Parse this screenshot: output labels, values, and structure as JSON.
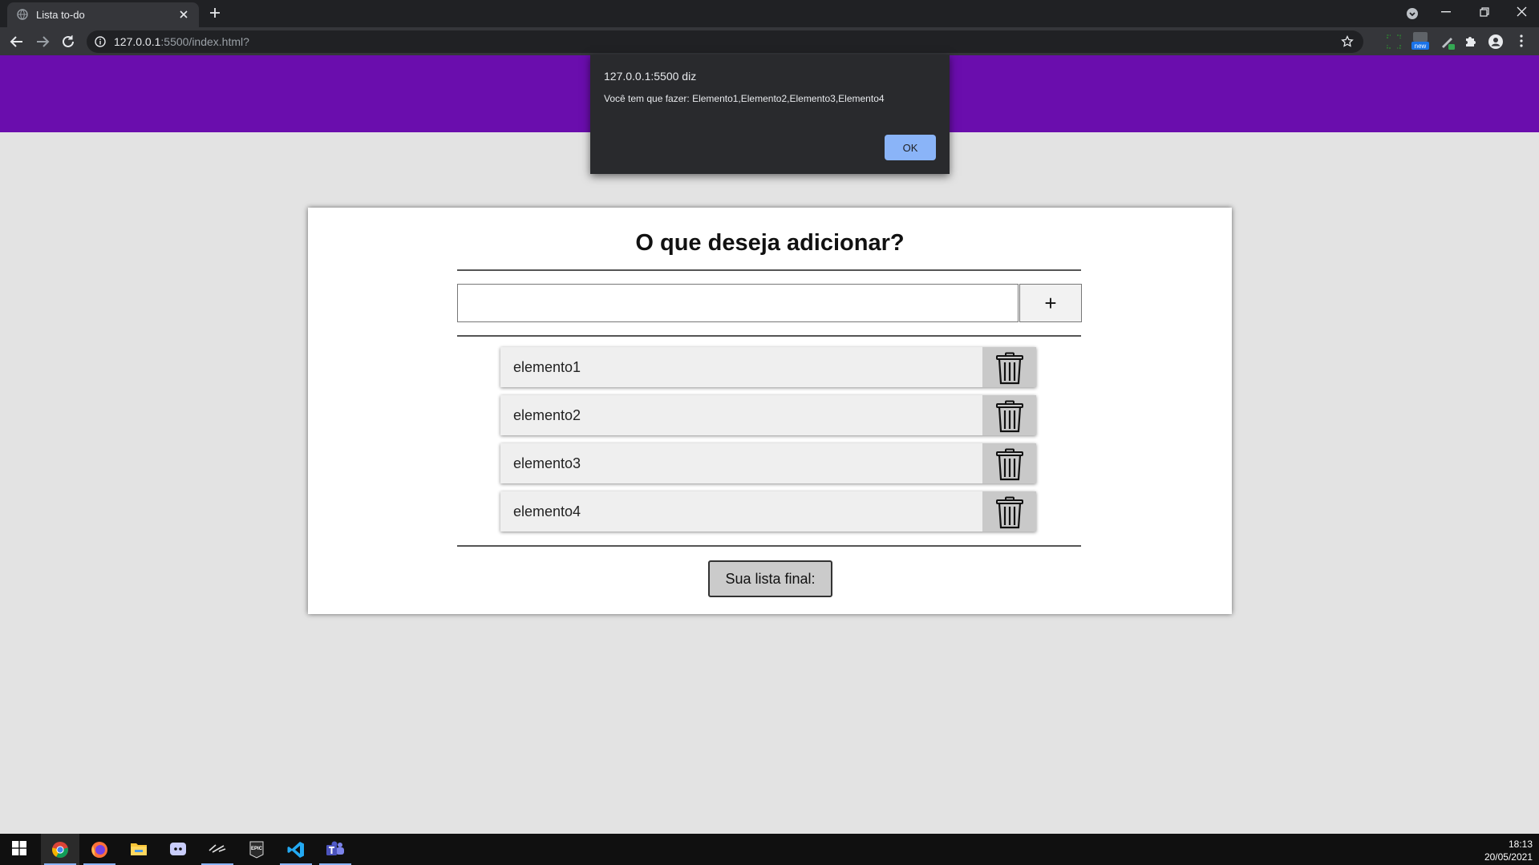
{
  "browser": {
    "tab_title": "Lista to-do",
    "url_host": "127.0.0.1",
    "url_path": ":5500/index.html?",
    "extension_badge": "new"
  },
  "alert": {
    "title": "127.0.0.1:5500 diz",
    "message": "Você tem que fazer: Elemento1,Elemento2,Elemento3,Elemento4",
    "ok_label": "OK"
  },
  "page": {
    "header_color": "#6a0dad",
    "title": "O que deseja adicionar?",
    "input_value": "",
    "add_label": "+",
    "items": [
      {
        "label": "elemento1"
      },
      {
        "label": "elemento2"
      },
      {
        "label": "elemento3"
      },
      {
        "label": "elemento4"
      }
    ],
    "final_button_label": "Sua lista final:"
  },
  "taskbar": {
    "apps": [
      "windows-start",
      "chrome",
      "firefox",
      "file-explorer",
      "discord",
      "hyperx",
      "epic-games",
      "vscode",
      "teams"
    ],
    "time": "18:13",
    "date": "20/05/2021"
  }
}
